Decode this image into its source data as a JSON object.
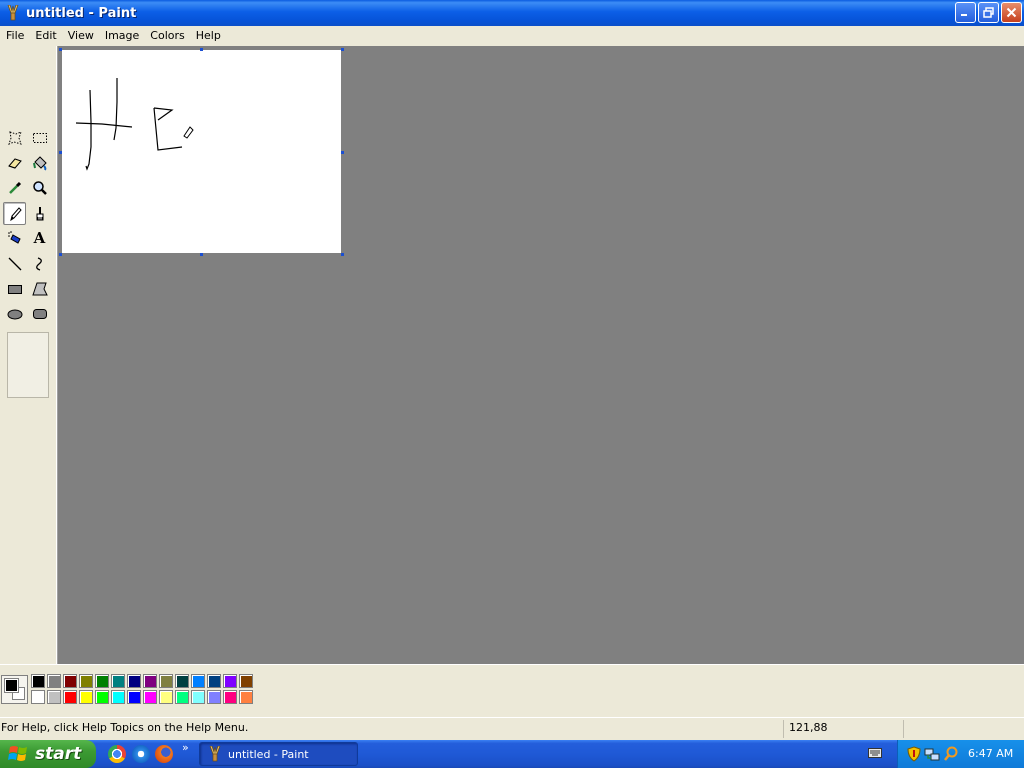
{
  "window": {
    "title": "untitled - Paint",
    "buttons": [
      "minimize",
      "restore",
      "close"
    ]
  },
  "menu": [
    "File",
    "Edit",
    "View",
    "Image",
    "Colors",
    "Help"
  ],
  "tools": [
    {
      "name": "free-form-select",
      "icon": "free-form-select-icon"
    },
    {
      "name": "select",
      "icon": "rect-select-icon"
    },
    {
      "name": "eraser",
      "icon": "eraser-icon"
    },
    {
      "name": "fill-with-color",
      "icon": "paint-bucket-icon"
    },
    {
      "name": "pick-color",
      "icon": "eyedropper-icon"
    },
    {
      "name": "magnifier",
      "icon": "magnifier-icon"
    },
    {
      "name": "pencil",
      "icon": "pencil-icon",
      "selected": true
    },
    {
      "name": "brush",
      "icon": "brush-icon"
    },
    {
      "name": "airbrush",
      "icon": "airbrush-icon"
    },
    {
      "name": "text",
      "icon": "text-icon",
      "label": "A"
    },
    {
      "name": "line",
      "icon": "line-icon"
    },
    {
      "name": "curve",
      "icon": "curve-icon"
    },
    {
      "name": "rectangle",
      "icon": "rectangle-icon"
    },
    {
      "name": "polygon",
      "icon": "polygon-icon"
    },
    {
      "name": "ellipse",
      "icon": "ellipse-icon"
    },
    {
      "name": "rounded-rectangle",
      "icon": "rounded-rectangle-icon"
    }
  ],
  "colors": {
    "foreground": "#000000",
    "background": "#ffffff",
    "palette_top": [
      "#000000",
      "#808080",
      "#800000",
      "#808000",
      "#008000",
      "#008080",
      "#000080",
      "#800080",
      "#808040",
      "#004040",
      "#0080ff",
      "#004080",
      "#8000ff",
      "#804000"
    ],
    "palette_bottom": [
      "#ffffff",
      "#c0c0c0",
      "#ff0000",
      "#ffff00",
      "#00ff00",
      "#00ffff",
      "#0000ff",
      "#ff00ff",
      "#ffff80",
      "#00ff80",
      "#80ffff",
      "#8080ff",
      "#ff0080",
      "#ff8040"
    ]
  },
  "status": {
    "help_text": "For Help, click Help Topics on the Help Menu.",
    "coordinates": "121,88"
  },
  "taskbar": {
    "start_label": "start",
    "quick_launch": [
      "chrome-icon",
      "internet-explorer-icon",
      "firefox-icon"
    ],
    "more": "»",
    "task_button_label": "untitled - Paint",
    "tray_icons": [
      "security-shield-icon",
      "network-icon",
      "search-icon"
    ],
    "clock": "6:47 AM"
  }
}
